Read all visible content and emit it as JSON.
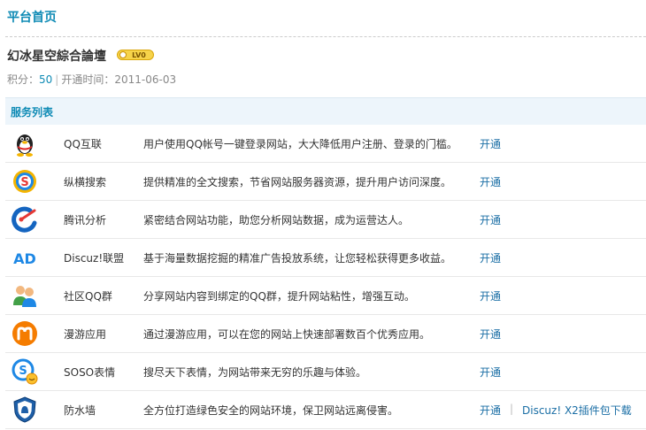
{
  "header": {
    "title": "平台首页"
  },
  "site": {
    "name": "幻冰星空綜合論壇",
    "level_badge": "LV0",
    "score_label": "积分：",
    "score_value": "50",
    "separator": "|",
    "open_time_label": "开通时间：",
    "open_time": "2011-06-03"
  },
  "services": {
    "header": "服务列表",
    "items": [
      {
        "icon": "qq-penguin-icon",
        "name": "QQ互联",
        "desc": "用户使用QQ帐号一键登录网站，大大降低用户注册、登录的门槛。",
        "action": "开通"
      },
      {
        "icon": "soso-search-icon",
        "name": "纵横搜索",
        "desc": "提供精准的全文搜索，节省网站服务器资源，提升用户访问深度。",
        "action": "开通"
      },
      {
        "icon": "analytics-icon",
        "name": "腾讯分析",
        "desc": "紧密结合网站功能，助您分析网站数据，成为运营达人。",
        "action": "开通"
      },
      {
        "icon": "ad-icon",
        "name": "Discuz!联盟",
        "desc": "基于海量数据挖掘的精准广告投放系统，让您轻松获得更多收益。",
        "action": "开通"
      },
      {
        "icon": "users-group-icon",
        "name": "社区QQ群",
        "desc": "分享网站内容到绑定的QQ群，提升网站粘性，增强互动。",
        "action": "开通"
      },
      {
        "icon": "manyou-icon",
        "name": "漫游应用",
        "desc": "通过漫游应用，可以在您的网站上快速部署数百个优秀应用。",
        "action": "开通"
      },
      {
        "icon": "soso-emoticon-icon",
        "name": "SOSO表情",
        "desc": "搜尽天下表情，为网站带来无穷的乐趣与体验。",
        "action": "开通"
      },
      {
        "icon": "firewall-shield-icon",
        "name": "防水墙",
        "desc": "全方位打造绿色安全的网站环境，保卫网站远离侵害。",
        "action": "开通",
        "extra_sep": "|",
        "extra_link": "Discuz! X2插件包下载"
      }
    ]
  },
  "colors": {
    "accent": "#0f8bb5",
    "link": "#1a6ea5",
    "header_bg": "#edf5fb"
  }
}
